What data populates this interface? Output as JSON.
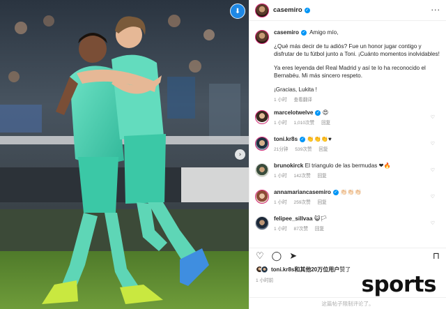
{
  "post": {
    "author": "casemiro",
    "caption_lines": [
      "Amigo mío,",
      "¿Qué más decir de tu adiós? Fue un honor jugar contigo y disfrutar de tu fútbol junto a Toni. ¡Cuánto momentos inolvidables!",
      "Ya eres leyenda del Real Madrid y así te lo ha reconocido el Bernabéu. Mi más sincero respeto.",
      "¡Gracias, Lukita !"
    ],
    "caption_time": "1 小时",
    "caption_translate": "查看翻译",
    "more_options": "···"
  },
  "comments": [
    {
      "user": "marcelotwelve",
      "verified": true,
      "text": "😍",
      "time": "1 小时",
      "likes": "1,010次赞",
      "reply": "回复"
    },
    {
      "user": "toni.kr8s",
      "verified": true,
      "text": "👏👏👏♥",
      "time": "21分钟",
      "likes": "539次赞",
      "reply": "回复"
    },
    {
      "user": "brunokirck",
      "verified": false,
      "text": "El triangulo de las bermudas ❤🔥",
      "time": "1 小时",
      "likes": "142次赞",
      "reply": "回复"
    },
    {
      "user": "annamariancasemiro",
      "verified": true,
      "text": "👏🏻👏🏻👏🏻",
      "time": "1 小时",
      "likes": "259次赞",
      "reply": "回复"
    },
    {
      "user": "felipee_sillvaa",
      "verified": false,
      "text": "😺🏳",
      "time": "1 小时",
      "likes": "87次赞",
      "reply": "回复"
    }
  ],
  "actions": {
    "like_icon": "♡",
    "comment_icon": "◯",
    "share_icon": "➤",
    "save_icon": "⊓"
  },
  "likes_summary": "toni.kr8s和其他20万位用户",
  "likes_suffix": "赞了",
  "posted_ago": "1 小时前",
  "comments_locked": "这篇帖子限制评论了。",
  "photo": {
    "download_badge": "⬇",
    "next_arrow": "›"
  },
  "watermark": "sports"
}
